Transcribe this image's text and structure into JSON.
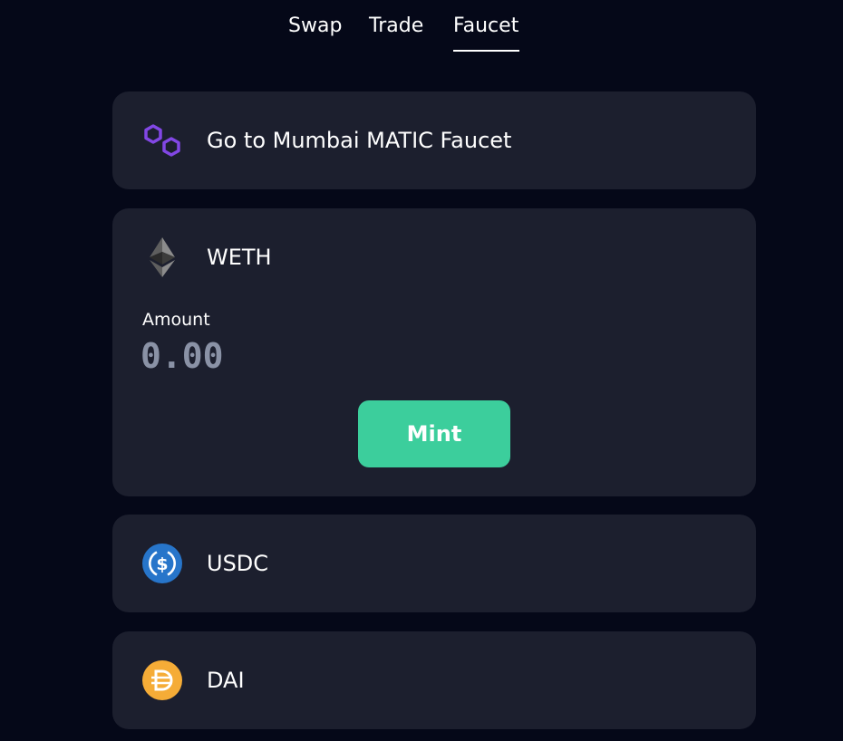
{
  "nav": {
    "tabs": [
      {
        "label": "Swap"
      },
      {
        "label": "Trade"
      },
      {
        "label": "Faucet",
        "active": true
      }
    ]
  },
  "faucet": {
    "matic_link": {
      "label": "Go to Mumbai MATIC Faucet",
      "icon": "polygon-icon"
    },
    "weth": {
      "label": "WETH",
      "icon": "ethereum-icon",
      "amount_label": "Amount",
      "amount_placeholder": "0.00",
      "mint_label": "Mint"
    },
    "usdc": {
      "label": "USDC",
      "icon": "usdc-icon"
    },
    "dai": {
      "label": "DAI",
      "icon": "dai-icon"
    }
  },
  "colors": {
    "background": "#050818",
    "card": "#1c1f2e",
    "accent": "#3cce9c",
    "polygon": "#8247e5",
    "usdc": "#2775ca",
    "dai": "#f5ac37"
  }
}
